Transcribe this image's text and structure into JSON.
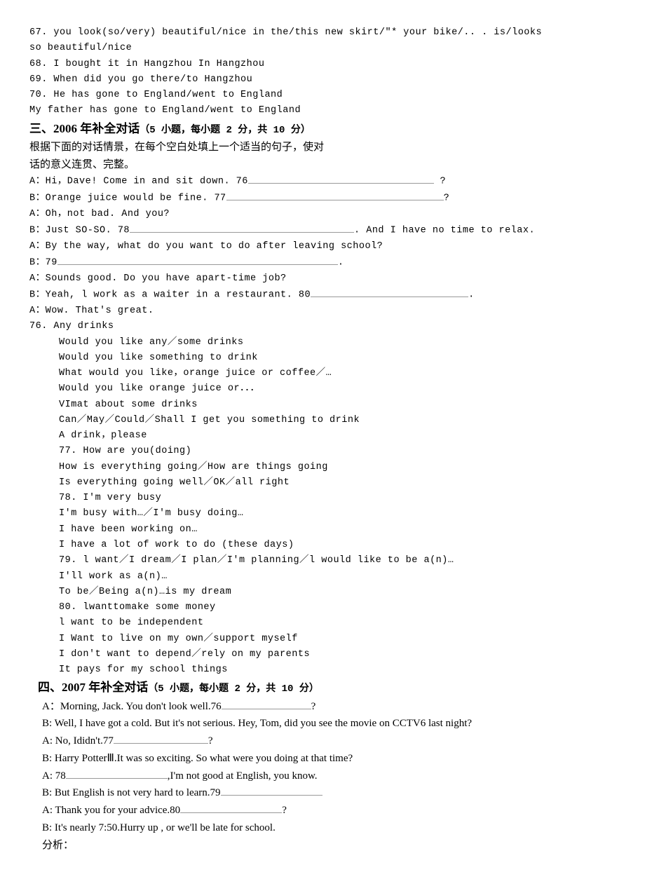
{
  "pre": {
    "l1": "  67.     you  look(so/very)   beautiful/nice   in  the/this  new  skirt/\"*  your  bike/.. .   is/looks",
    "l2": "so    beautiful/nice",
    "l3": "68.    I bought it in Hangzhou In Hangzhou",
    "l4": "69. When did you go there/to Hangzhou",
    "l5": "70.   He has gone to England/went to England",
    "l6": "My father has gone to England/went to England"
  },
  "sec3": {
    "title": "三、2006 年补全对话",
    "subtitle": "（5 小题，每小题 2 分，共 10 分）",
    "intro1": "根据下面的对话情景，在每个空白处填上一个适当的句子，使对",
    "intro2": "话的意义连贯、完整。",
    "d1_a": "A：Hi，Dave! Come in and sit down. 76",
    "d1_q": " ?",
    "d2_a": "B：Orange juice would be fine. 77",
    "d2_q": "?",
    "d3": "A：Oh，not bad. And you?",
    "d4_a": "B：Just SO-SO. 78",
    "d4_b": ". And I have no time  to relax.",
    "d5": "A：By the way, what do you want to do after leaving school?",
    "d6": "B：79",
    "d6_b": ".",
    "d7": "A：Sounds good. Do you have apart-time job?",
    "d8_a": "B：Yeah, l work as a waiter in a restaurant. 80",
    "d8_b": ".",
    "d9": "A：Wow. That's great.",
    "a76": "76. Any drinks",
    "a76_1": "Would you like any／some drinks",
    "a76_2": "Would you like something to drink",
    "a76_3": "What would you like，orange juice or coffee／…",
    "a76_4": "Would you like orange juice or．．．",
    "a76_5": "VImat about some drinks",
    "a76_6": "Can／May／Could／Shall I get you something to drink",
    "a76_7": "A drink，please",
    "a77": "77. How are you(doing)",
    "a77_1": "How is everything going／How are things going",
    "a77_2": "Is everything going well／OK／all right",
    "a78": "78. I'm very busy",
    "a78_1": "I'm busy with…／I'm busy doing…",
    "a78_2": "I have been working on…",
    "a78_3": "I have a lot of work to do (these days)",
    "a79": "79. l want／I dream／I plan／I'm planning／l would like to be a(n)…",
    "a79_1": "I'll work as a(n)…",
    "a79_2": "To be／Being a(n)…is my dream",
    "a80": "80. lwanttomake some money",
    "a80_1": "l want to be independent",
    "a80_2": "I Want to live on my own／support myself",
    "a80_3": "I don't want to depend／rely on my parents",
    "a80_4": "It pays for my school things"
  },
  "sec4": {
    "title": "四、2007 年补全对话",
    "subtitle": "（5 小题，每小题 2 分，共 10 分）",
    "d1_a": "A：Morning, Jack. You don't look well.76",
    "d1_q": "?",
    "d2": "B: Well, I have got a cold. But it's not serious. Hey, Tom, did you see the movie on CCTV6 last night?",
    "d3_a": "A: No, Ididn't.77",
    "d3_q": "?",
    "d4": "B: Harry PotterⅢ.It was so exciting. So what were you doing at that time?",
    "d5_a": "A: 78",
    "d5_b": ",I'm not good at English, you know.",
    "d6_a": "B: But English is not very hard to learn.79",
    "d7_a": "A: Thank you for your advice.80",
    "d7_q": "?",
    "d8": "B: It's nearly 7:50.Hurry up , or we'll be late for school.",
    "analysis": "分析："
  }
}
